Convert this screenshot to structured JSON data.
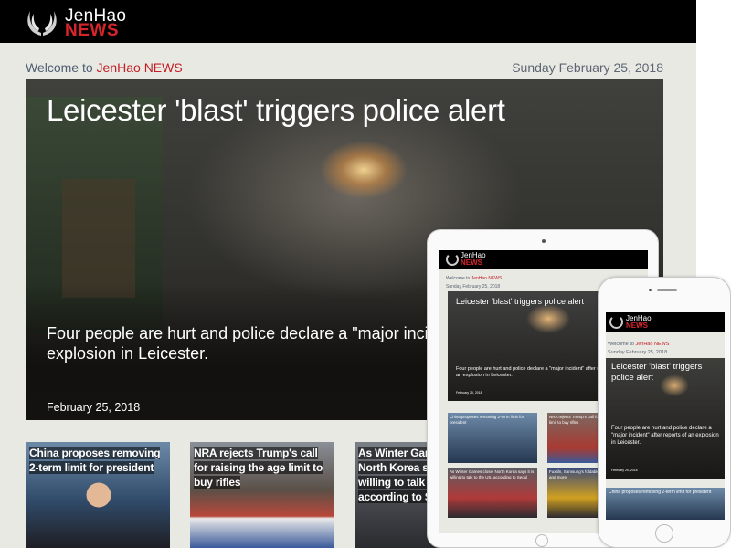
{
  "brand": {
    "line1": "JenHao",
    "line2": "NEWS"
  },
  "welcome": {
    "prefix": "Welcome to ",
    "site": "JenHao NEWS"
  },
  "date": "Sunday February 25, 2018",
  "hero": {
    "title": "Leicester 'blast' triggers police alert",
    "summary": "Four people are hurt and police declare a \"major incident\" after reports of an explosion in Leicester.",
    "date": "February 25, 2018"
  },
  "cards": [
    {
      "title": "China proposes removing 2-term limit for president"
    },
    {
      "title": "NRA rejects Trump's call for raising the age limit to buy rifles"
    },
    {
      "title": "As Winter Games close, North Korea says it is willing to talk to the US, according to Seoul"
    }
  ],
  "tablet": {
    "date": "Sunday February 25, 2018",
    "hero_date": "February 25, 2018",
    "cards": [
      {
        "title": "China proposes removing 2-term limit for president"
      },
      {
        "title": "NRA rejects Trump's call for raising the age limit to buy rifles"
      },
      {
        "title": "As Winter Games close, North Korea says it is willing to talk to the US, according to Seoul"
      },
      {
        "title": "Fuxtiln, Samsung's foldable phone, 7 Android and more"
      }
    ]
  },
  "phone": {
    "date": "Sunday February 25, 2018",
    "hero_date": "February 25, 2018",
    "card": {
      "title": "China proposes removing 2-term limit for president"
    }
  },
  "colors": {
    "accent": "#c21e25",
    "topbar": "#000000",
    "background": "#e9e9e3",
    "text_muted": "#4e5d70"
  }
}
